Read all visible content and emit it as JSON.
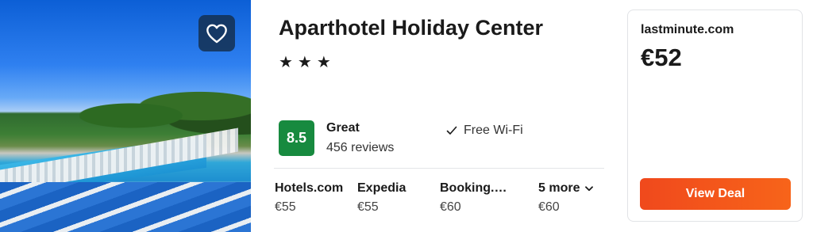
{
  "hotel": {
    "name": "Aparthotel Holiday Center",
    "stars": "★★★",
    "favorite_icon": "heart-outline-icon"
  },
  "rating": {
    "score": "8.5",
    "label": "Great",
    "reviews": "456 reviews",
    "badge_color": "#178a3f"
  },
  "amenities": [
    {
      "icon": "check-icon",
      "label": "Free Wi-Fi"
    }
  ],
  "providers": [
    {
      "name": "Hotels.com",
      "price": "€55"
    },
    {
      "name": "Expedia",
      "price": "€55"
    },
    {
      "name": "Booking.…",
      "price": "€60"
    },
    {
      "name": "5 more",
      "price": "€60",
      "icon": "chevron-down-icon"
    }
  ],
  "deal": {
    "provider": "lastminute.com",
    "price": "€52",
    "button_label": "View Deal",
    "button_color": "#f25420"
  }
}
